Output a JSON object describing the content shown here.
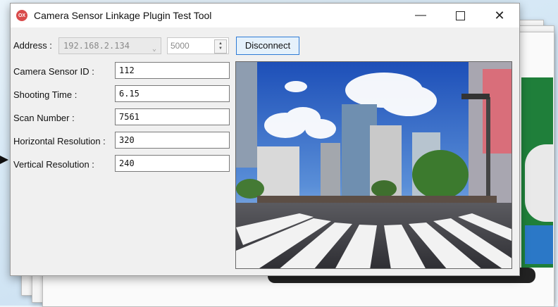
{
  "window": {
    "title": "Camera Sensor Linkage Plugin Test Tool",
    "icon_text": "OX"
  },
  "connection": {
    "address_label": "Address :",
    "address_value": "192.168.2.134",
    "port_value": "5000",
    "disconnect_label": "Disconnect"
  },
  "fields": [
    {
      "label": "Camera Sensor ID :",
      "value": "112"
    },
    {
      "label": "Shooting Time :",
      "value": "6.15"
    },
    {
      "label": "Scan Number :",
      "value": "7561"
    },
    {
      "label": "Horizontal Resolution :",
      "value": "320"
    },
    {
      "label": "Vertical Resolution :",
      "value": "240"
    }
  ],
  "colors": {
    "accent": "#2e7bd6",
    "app_icon": "#d94b4b"
  },
  "icons": [
    "app-icon",
    "minimize-icon",
    "maximize-icon",
    "close-icon",
    "dropdown-arrow-icon",
    "spin-up-icon",
    "spin-down-icon"
  ]
}
